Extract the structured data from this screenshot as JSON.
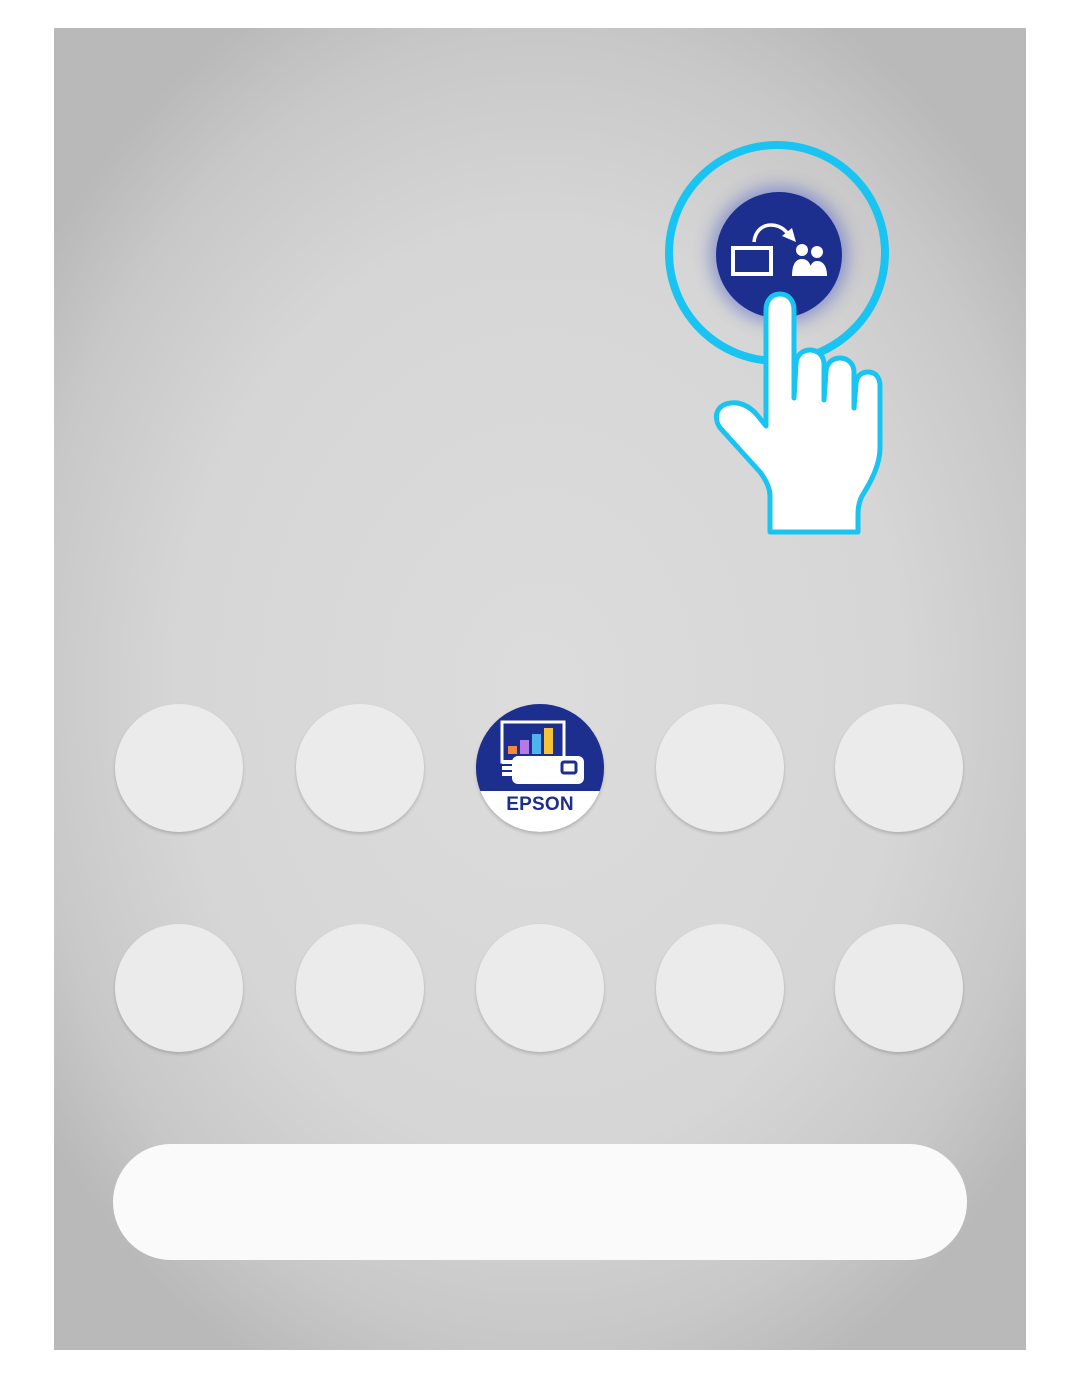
{
  "screen": {
    "share_button": {
      "icon": "screen-share-to-group-icon",
      "color": "#1c2e8e"
    },
    "highlight_ring": {
      "color": "#1ac4f2"
    },
    "pointer": {
      "icon": "tap-hand-icon",
      "color": "#1ac4f2"
    }
  },
  "home": {
    "row1": [
      {
        "app": "placeholder-app"
      },
      {
        "app": "placeholder-app"
      },
      {
        "app": "epson-iprojection-app",
        "label": "EPSON"
      },
      {
        "app": "placeholder-app"
      },
      {
        "app": "placeholder-app"
      }
    ],
    "row2": [
      {
        "app": "placeholder-app"
      },
      {
        "app": "placeholder-app"
      },
      {
        "app": "placeholder-app"
      },
      {
        "app": "placeholder-app"
      },
      {
        "app": "placeholder-app"
      }
    ],
    "dock": {
      "color": "#fafafa"
    }
  }
}
